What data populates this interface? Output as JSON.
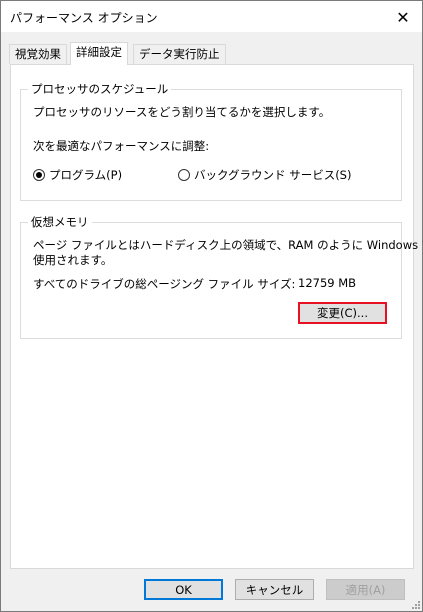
{
  "window": {
    "title": "パフォーマンス オプション"
  },
  "tabs": [
    {
      "label": "視覚効果"
    },
    {
      "label": "詳細設定"
    },
    {
      "label": "データ実行防止"
    }
  ],
  "processor": {
    "group_title": "プロセッサのスケジュール",
    "description": "プロセッサのリソースをどう割り当てるかを選択します。",
    "adjust_label": "次を最適なパフォーマンスに調整:",
    "options": [
      {
        "label": "プログラム(P)",
        "selected": true
      },
      {
        "label": "バックグラウンド サービス(S)",
        "selected": false
      }
    ]
  },
  "virtual_memory": {
    "group_title": "仮想メモリ",
    "description_line1": "ページ ファイルとはハードディスク上の領域で、RAM のように Windows で",
    "description_line2": "使用されます。",
    "paging_label": "すべてのドライブの総ページング ファイル サイズ:",
    "paging_value": "12759 MB",
    "change_button": "変更(C)..."
  },
  "buttons": {
    "ok": "OK",
    "cancel": "キャンセル",
    "apply": "適用(A)"
  },
  "icons": {
    "close": "close-icon",
    "resize": "resize-grip-icon"
  },
  "colors": {
    "highlight": "#e81123",
    "default_button_border": "#0078d7"
  }
}
